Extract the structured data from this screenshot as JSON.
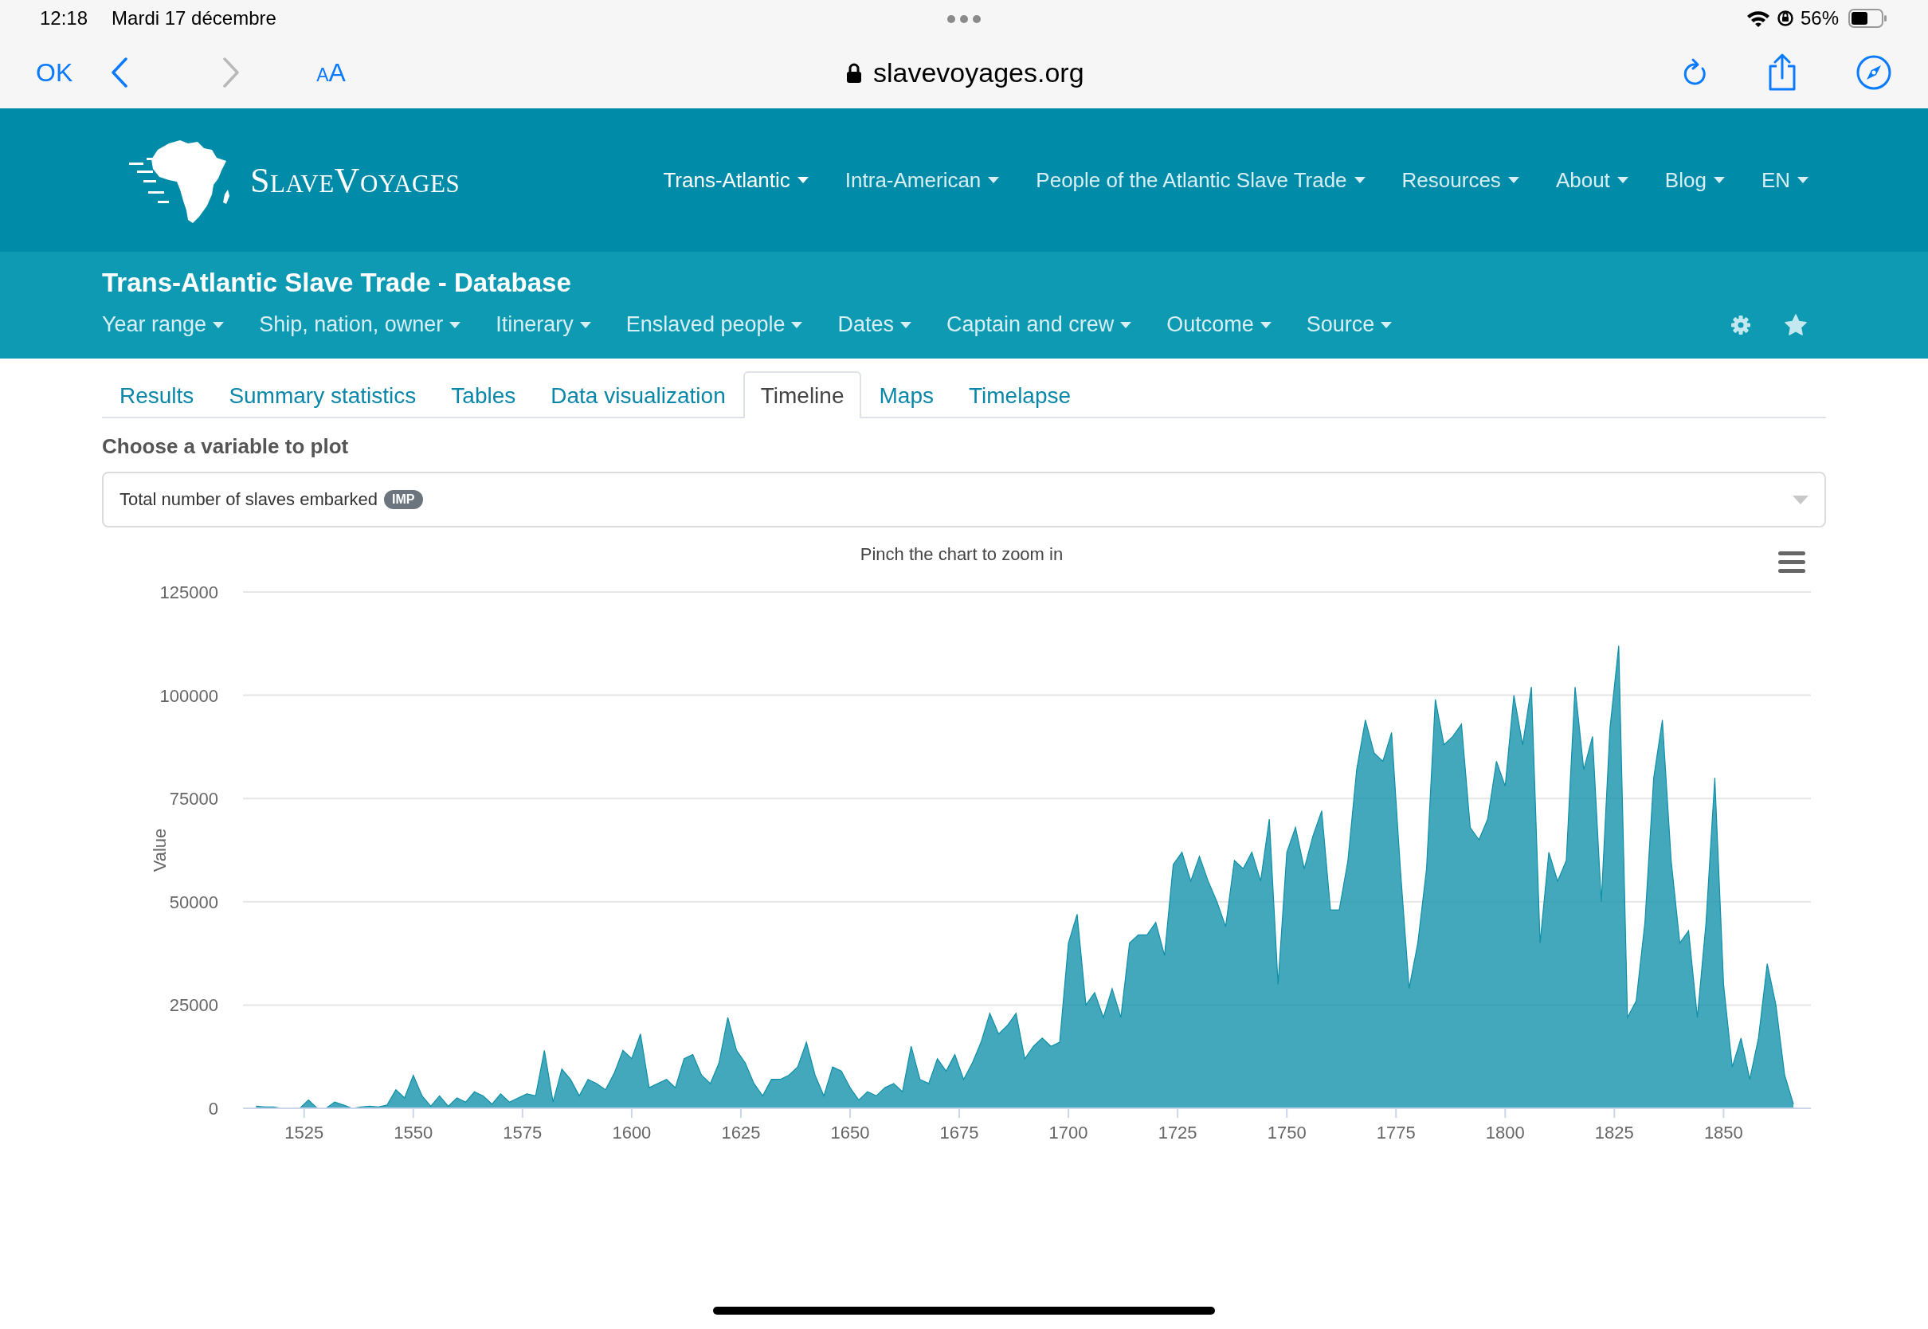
{
  "status_bar": {
    "time": "12:18",
    "date": "Mardi 17 décembre",
    "battery": "56%"
  },
  "browser": {
    "done": "OK",
    "back": {
      "disabled": false
    },
    "forward": {
      "disabled": true
    },
    "text_size": "AA",
    "url": "slavevoyages.org"
  },
  "site": {
    "logo": "SlaveVoyages",
    "nav": [
      {
        "label": "Trans-Atlantic",
        "selected": true
      },
      {
        "label": "Intra-American",
        "selected": false
      },
      {
        "label": "People of the Atlantic Slave Trade",
        "selected": false
      },
      {
        "label": "Resources",
        "selected": false
      },
      {
        "label": "About",
        "selected": false
      },
      {
        "label": "Blog",
        "selected": false
      },
      {
        "label": "EN",
        "selected": false
      }
    ]
  },
  "database": {
    "title": "Trans-Atlantic Slave Trade - Database",
    "filters": [
      "Year range",
      "Ship, nation, owner",
      "Itinerary",
      "Enslaved people",
      "Dates",
      "Captain and crew",
      "Outcome",
      "Source"
    ]
  },
  "tabs": [
    {
      "label": "Results",
      "selected": false
    },
    {
      "label": "Summary statistics",
      "selected": false
    },
    {
      "label": "Tables",
      "selected": false
    },
    {
      "label": "Data visualization",
      "selected": false
    },
    {
      "label": "Timeline",
      "selected": true
    },
    {
      "label": "Maps",
      "selected": false
    },
    {
      "label": "Timelapse",
      "selected": false
    }
  ],
  "plot": {
    "label": "Choose a variable to plot",
    "select": {
      "value": "Total number of slaves embarked",
      "badge": "IMP"
    },
    "chart": {
      "hint": "Pinch the chart to zoom in",
      "chart_data": {
        "type": "area",
        "ylabel": "Value",
        "grid": true,
        "xlim": [
          1511,
          1870
        ],
        "ylim": [
          0,
          125000
        ],
        "yticks": [
          0,
          25000,
          50000,
          75000,
          100000,
          125000
        ],
        "xticks": [
          1525,
          1550,
          1575,
          1600,
          1625,
          1650,
          1675,
          1700,
          1725,
          1750,
          1775,
          1800,
          1825,
          1850
        ],
        "x": [
          1514,
          1516,
          1518,
          1520,
          1522,
          1524,
          1526,
          1528,
          1530,
          1532,
          1534,
          1536,
          1538,
          1540,
          1542,
          1544,
          1546,
          1548,
          1550,
          1552,
          1554,
          1556,
          1558,
          1560,
          1562,
          1564,
          1566,
          1568,
          1570,
          1572,
          1574,
          1576,
          1578,
          1580,
          1582,
          1584,
          1586,
          1588,
          1590,
          1592,
          1594,
          1596,
          1598,
          1600,
          1602,
          1604,
          1606,
          1608,
          1610,
          1612,
          1614,
          1616,
          1618,
          1620,
          1622,
          1624,
          1626,
          1628,
          1630,
          1632,
          1634,
          1636,
          1638,
          1640,
          1642,
          1644,
          1646,
          1648,
          1650,
          1652,
          1654,
          1656,
          1658,
          1660,
          1662,
          1664,
          1666,
          1668,
          1670,
          1672,
          1674,
          1676,
          1678,
          1680,
          1682,
          1684,
          1686,
          1688,
          1690,
          1692,
          1694,
          1696,
          1698,
          1700,
          1702,
          1704,
          1706,
          1708,
          1710,
          1712,
          1714,
          1716,
          1718,
          1720,
          1722,
          1724,
          1726,
          1728,
          1730,
          1732,
          1734,
          1736,
          1738,
          1740,
          1742,
          1744,
          1746,
          1748,
          1750,
          1752,
          1754,
          1756,
          1758,
          1760,
          1762,
          1764,
          1766,
          1768,
          1770,
          1772,
          1774,
          1776,
          1778,
          1780,
          1782,
          1784,
          1786,
          1788,
          1790,
          1792,
          1794,
          1796,
          1798,
          1800,
          1802,
          1804,
          1806,
          1808,
          1810,
          1812,
          1814,
          1816,
          1818,
          1820,
          1822,
          1824,
          1826,
          1828,
          1830,
          1832,
          1834,
          1836,
          1838,
          1840,
          1842,
          1844,
          1846,
          1848,
          1850,
          1852,
          1854,
          1856,
          1858,
          1860,
          1862,
          1864,
          1866
        ],
        "series": [
          {
            "color": "#0e8fa8",
            "values": [
              500,
              300,
              300,
              0,
              0,
              0,
              2000,
              0,
              0,
              1500,
              800,
              0,
              300,
              500,
              300,
              800,
              4500,
              2500,
              8000,
              3000,
              500,
              3000,
              500,
              2500,
              1500,
              4000,
              3000,
              1000,
              3500,
              1500,
              2500,
              3500,
              3000,
              14000,
              1500,
              9500,
              7000,
              3000,
              7000,
              6000,
              4500,
              8500,
              14000,
              12000,
              18000,
              5000,
              6000,
              7000,
              5000,
              12000,
              13000,
              8000,
              6000,
              11000,
              22000,
              14000,
              11000,
              6000,
              3000,
              7000,
              7000,
              8000,
              10000,
              16000,
              8000,
              3000,
              10000,
              9000,
              5000,
              2000,
              4000,
              3000,
              5000,
              6000,
              4000,
              15000,
              7000,
              6000,
              12000,
              9000,
              13000,
              7000,
              11000,
              16000,
              23000,
              18000,
              20000,
              23000,
              12000,
              15000,
              17000,
              15000,
              16000,
              40000,
              47000,
              25000,
              28000,
              22000,
              29000,
              22000,
              40000,
              42000,
              42000,
              45000,
              37000,
              59000,
              62000,
              55000,
              61000,
              55000,
              50000,
              44000,
              60000,
              58000,
              62000,
              55000,
              70000,
              30000,
              62000,
              68000,
              58000,
              66000,
              72000,
              48000,
              48000,
              60000,
              82000,
              94000,
              86000,
              84000,
              91000,
              58000,
              29000,
              40000,
              58000,
              99000,
              88000,
              90000,
              93000,
              68000,
              65000,
              70000,
              84000,
              78000,
              100000,
              88000,
              102000,
              40000,
              62000,
              55000,
              60000,
              102000,
              82000,
              90000,
              50000,
              92000,
              112000,
              22000,
              26000,
              45000,
              80000,
              94000,
              60000,
              40000,
              43000,
              22000,
              45000,
              80000,
              30000,
              10000,
              17000,
              7000,
              17000,
              35000,
              25000,
              8000,
              1000
            ]
          }
        ]
      }
    }
  }
}
